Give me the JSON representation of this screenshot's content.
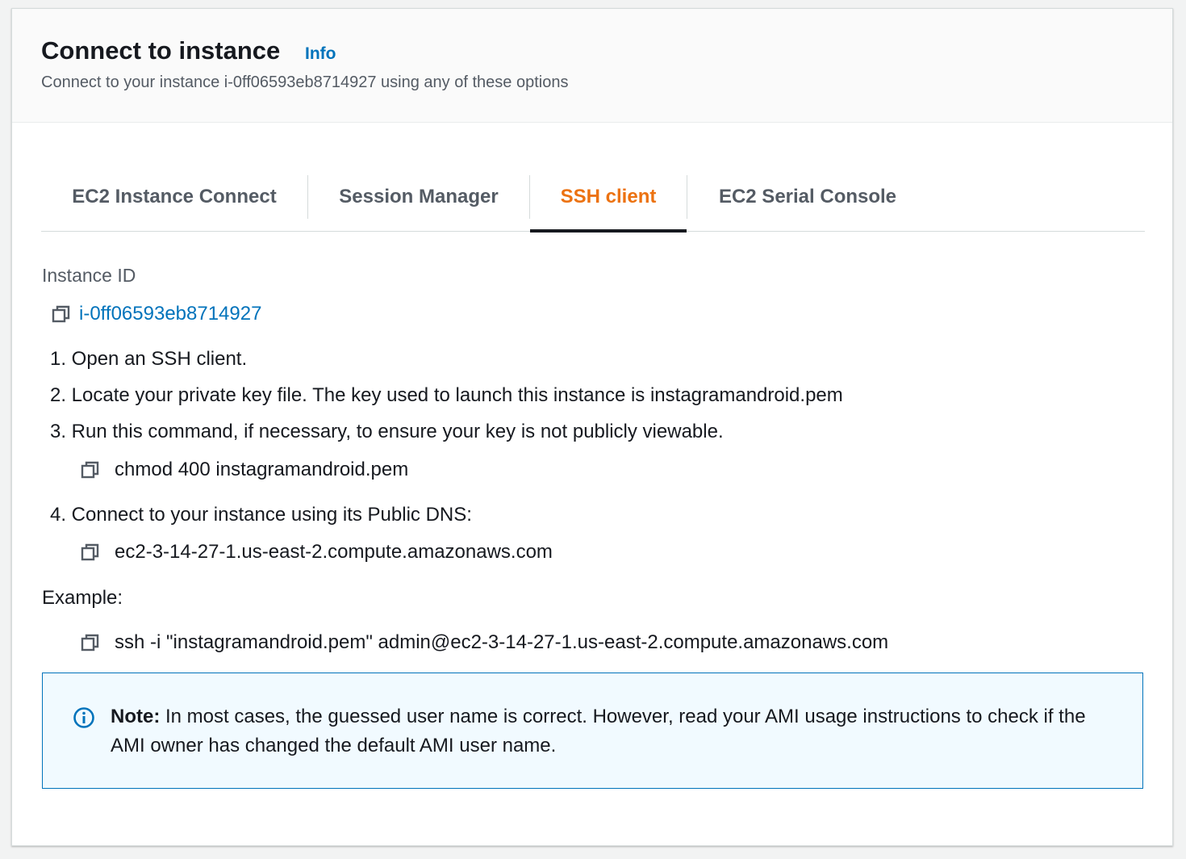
{
  "header": {
    "title": "Connect to instance",
    "info_label": "Info",
    "subtitle": "Connect to your instance i-0ff06593eb8714927 using any of these options"
  },
  "tabs": [
    {
      "label": "EC2 Instance Connect",
      "active": false
    },
    {
      "label": "Session Manager",
      "active": false
    },
    {
      "label": "SSH client",
      "active": true
    },
    {
      "label": "EC2 Serial Console",
      "active": false
    }
  ],
  "instance": {
    "label": "Instance ID",
    "id": "i-0ff06593eb8714927"
  },
  "steps": [
    "1. Open an SSH client.",
    "2. Locate your private key file. The key used to launch this instance is instagramandroid.pem",
    "3. Run this command, if necessary, to ensure your key is not publicly viewable.",
    "4. Connect to your instance using its Public DNS:"
  ],
  "commands": {
    "chmod": "chmod 400 instagramandroid.pem",
    "public_dns": "ec2-3-14-27-1.us-east-2.compute.amazonaws.com",
    "example_label": "Example:",
    "ssh": "ssh -i \"instagramandroid.pem\" admin@ec2-3-14-27-1.us-east-2.compute.amazonaws.com"
  },
  "note": {
    "prefix": "Note:",
    "text": " In most cases, the guessed user name is correct. However, read your AMI usage instructions to check if the AMI owner has changed the default AMI user name."
  },
  "icons": {
    "copy": "copy-icon",
    "info": "info-circle-icon"
  },
  "colors": {
    "accent_link": "#0073bb",
    "active_tab": "#ec7211",
    "text": "#16191f",
    "muted": "#545b64",
    "note_bg": "#f1faff"
  }
}
